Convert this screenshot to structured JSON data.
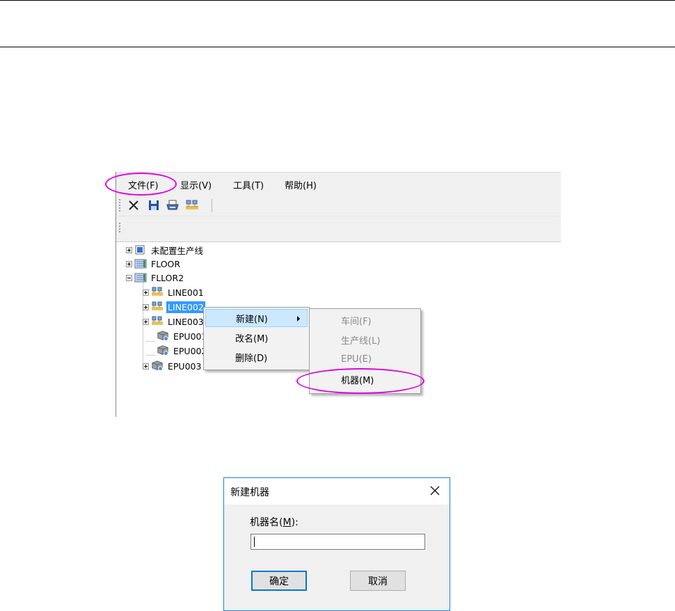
{
  "menubar": {
    "items": [
      "文件(F)",
      "显示(V)",
      "工具(T)",
      "帮助(H)"
    ]
  },
  "toolbar": {
    "buttons": [
      "delete-icon",
      "save-icon",
      "print-icon",
      "network-icon"
    ]
  },
  "tree": {
    "nodes": [
      {
        "label": "未配置生产线",
        "icon": "unconfigured-line-icon",
        "expander": "plus"
      },
      {
        "label": "FLOOR",
        "icon": "floor-icon",
        "expander": "plus"
      },
      {
        "label": "FLLOR2",
        "icon": "floor-icon",
        "expander": "minus"
      },
      {
        "label": "LINE001",
        "icon": "line-icon",
        "expander": "plus"
      },
      {
        "label": "LINE002",
        "icon": "line-icon",
        "expander": "plus",
        "selected": true
      },
      {
        "label": "LINE003",
        "icon": "line-icon",
        "expander": "plus"
      },
      {
        "label": "EPU001",
        "icon": "epu-icon",
        "expander": "none"
      },
      {
        "label": "EPU002",
        "icon": "epu-icon",
        "expander": "none"
      },
      {
        "label": "EPU003",
        "icon": "epu-icon",
        "expander": "plus"
      }
    ]
  },
  "context_menu": {
    "items": [
      {
        "label": "新建(N)",
        "submenu": true,
        "highlighted": true
      },
      {
        "label": "改名(M)"
      },
      {
        "label": "删除(D)"
      }
    ]
  },
  "submenu": {
    "items": [
      {
        "label": "车间(F)",
        "disabled": true
      },
      {
        "label": "生产线(L)",
        "disabled": true
      },
      {
        "label": "EPU(E)",
        "disabled": true
      },
      {
        "label": "机器(M)",
        "disabled": false
      }
    ]
  },
  "dialog": {
    "title": "新建机器",
    "field_label_prefix": "机器名(",
    "field_label_mnemonic": "M",
    "field_label_suffix": "):",
    "field_value": "",
    "ok_label": "确定",
    "cancel_label": "取消"
  },
  "colors": {
    "highlight_ellipse": "#e100e1",
    "selection": "#3399ff",
    "menu_hover": "#cce8ff",
    "dialog_border": "#1883d7"
  }
}
